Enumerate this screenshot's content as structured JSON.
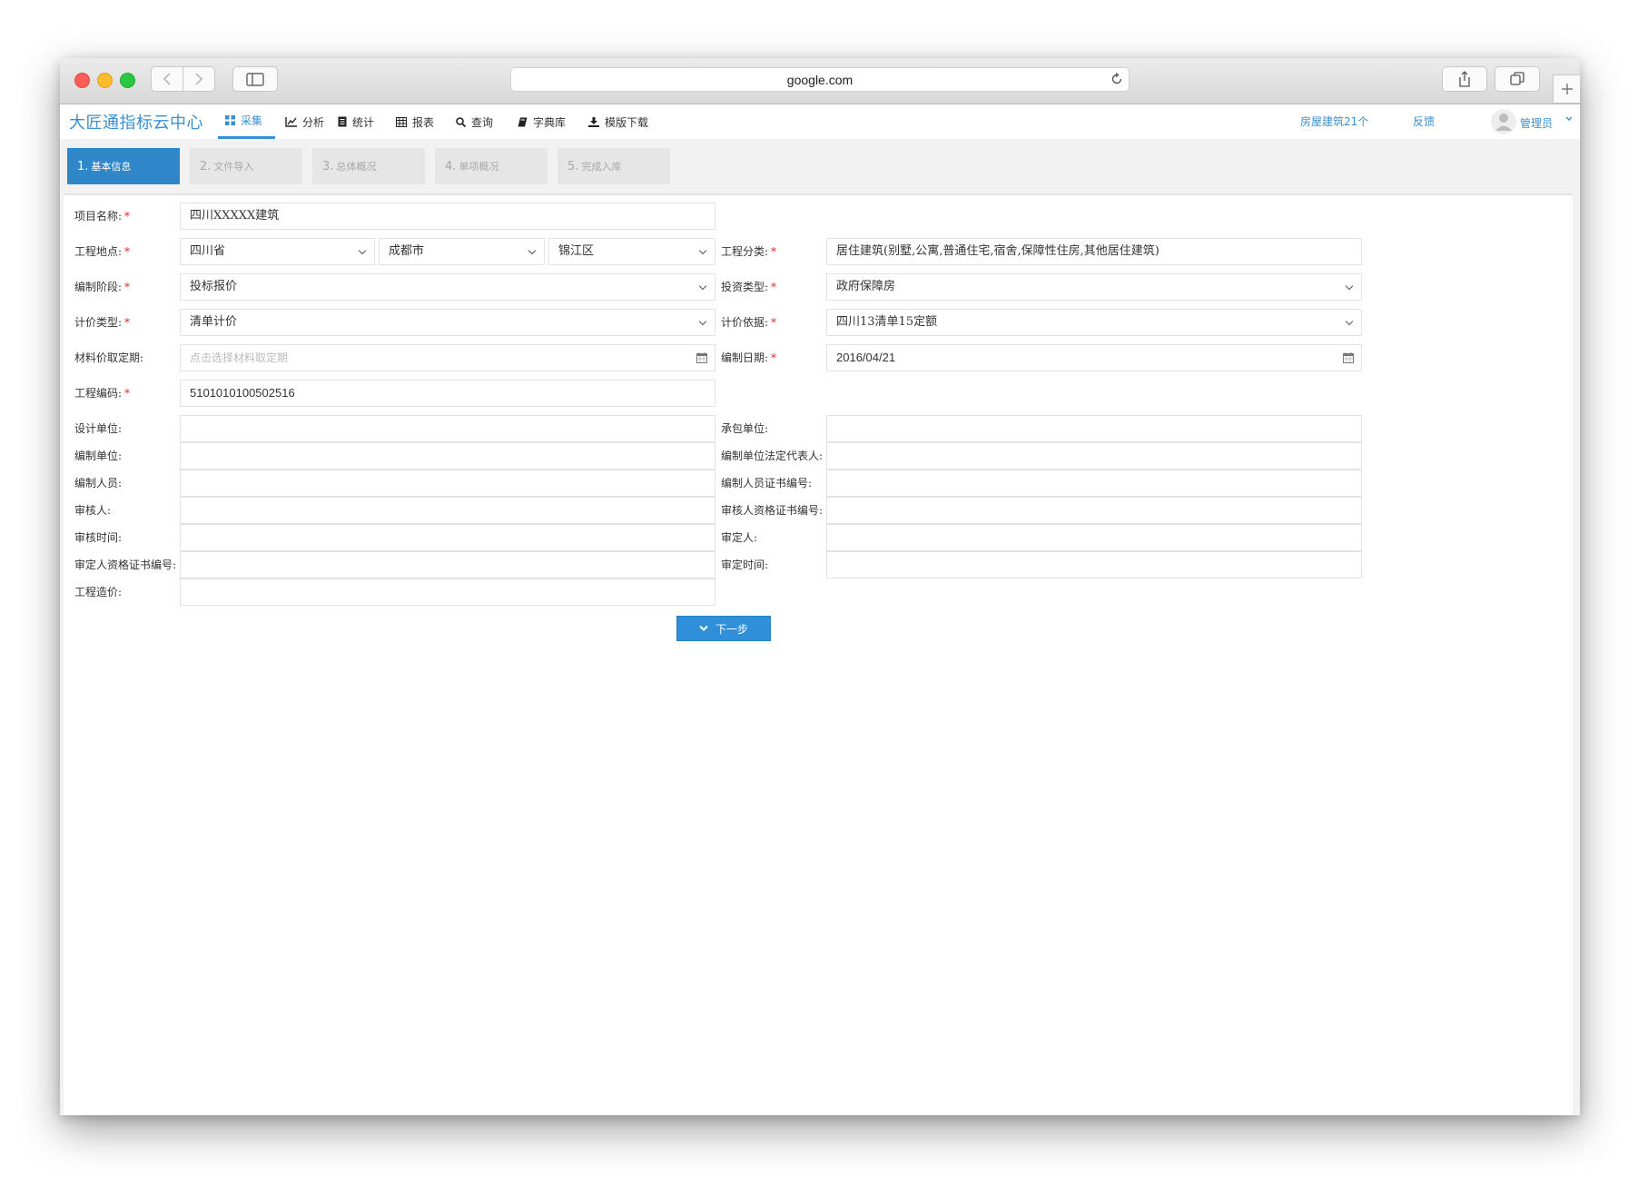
{
  "browser": {
    "url": "google.com"
  },
  "app": {
    "title": "大匠通指标云中心",
    "nav": [
      {
        "label": "采集",
        "icon": "grid-icon",
        "active": true
      },
      {
        "label": "分析",
        "icon": "line-chart-icon"
      },
      {
        "label": "统计",
        "icon": "document-icon"
      },
      {
        "label": "报表",
        "icon": "table-icon"
      },
      {
        "label": "查询",
        "icon": "search-icon"
      },
      {
        "label": "字典库",
        "icon": "book-icon"
      },
      {
        "label": "模版下载",
        "icon": "download-icon"
      }
    ],
    "projects_link": "房屋建筑21个",
    "feedback_link": "反馈",
    "user_name": "管理员"
  },
  "steps": [
    {
      "num": "1.",
      "label": "基本信息",
      "active": true
    },
    {
      "num": "2.",
      "label": "文件导入"
    },
    {
      "num": "3.",
      "label": "总体概况"
    },
    {
      "num": "4.",
      "label": "单项概况"
    },
    {
      "num": "5.",
      "label": "完成入库"
    }
  ],
  "form": {
    "project_name": {
      "label": "项目名称:",
      "value": "四川XXXXX建筑"
    },
    "location": {
      "label": "工程地点:",
      "province": "四川省",
      "city": "成都市",
      "district": "锦江区"
    },
    "category": {
      "label": "工程分类:",
      "value": "居住建筑(别墅,公寓,普通住宅,宿舍,保障性住房,其他居住建筑)"
    },
    "stage": {
      "label": "编制阶段:",
      "value": "投标报价"
    },
    "investment_type": {
      "label": "投资类型:",
      "value": "政府保障房"
    },
    "pricing_type": {
      "label": "计价类型:",
      "value": "清单计价"
    },
    "pricing_basis": {
      "label": "计价依据:",
      "value": "四川13清单15定额"
    },
    "material_date": {
      "label": "材料价取定期:",
      "placeholder": "点击选择材料取定期"
    },
    "compile_date": {
      "label": "编制日期:",
      "value": "2016/04/21"
    },
    "project_code": {
      "label": "工程编码:",
      "value": "5101010100502516"
    },
    "design_unit": {
      "label": "设计单位:"
    },
    "contractor": {
      "label": "承包单位:"
    },
    "compile_unit": {
      "label": "编制单位:"
    },
    "legal_rep": {
      "label": "编制单位法定代表人:"
    },
    "compiler": {
      "label": "编制人员:"
    },
    "compiler_cert": {
      "label": "编制人员证书编号:"
    },
    "reviewer": {
      "label": "审核人:"
    },
    "reviewer_cert": {
      "label": "审核人资格证书编号:"
    },
    "review_time": {
      "label": "审核时间:"
    },
    "approver": {
      "label": "审定人:"
    },
    "approver_cert": {
      "label": "审定人资格证书编号:"
    },
    "approve_time": {
      "label": "审定时间:"
    },
    "project_cost": {
      "label": "工程造价:"
    },
    "next_button": "下一步"
  },
  "colors": {
    "accent": "#2f86c9",
    "required": "#d9322a"
  }
}
